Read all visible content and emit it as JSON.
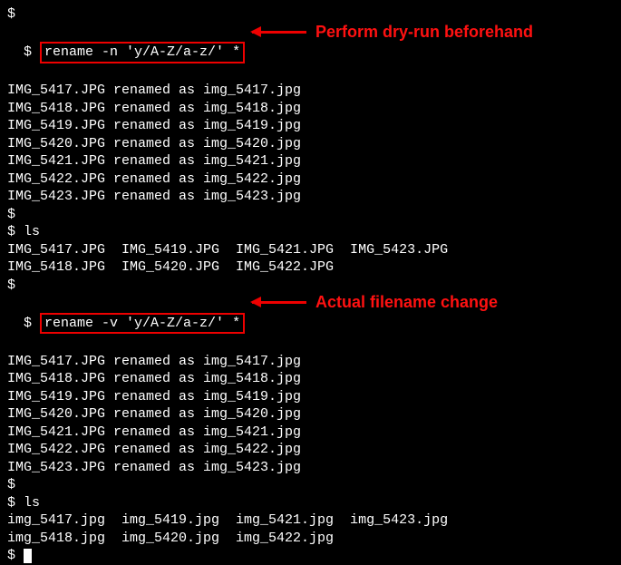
{
  "prompt": "$",
  "block1": {
    "prefix": "$ ",
    "cmd": "rename -n 'y/A-Z/a-z/' *",
    "annotation": "Perform dry-run beforehand",
    "output": [
      "IMG_5417.JPG renamed as img_5417.jpg",
      "IMG_5418.JPG renamed as img_5418.jpg",
      "IMG_5419.JPG renamed as img_5419.jpg",
      "IMG_5420.JPG renamed as img_5420.jpg",
      "IMG_5421.JPG renamed as img_5421.jpg",
      "IMG_5422.JPG renamed as img_5422.jpg",
      "IMG_5423.JPG renamed as img_5423.jpg"
    ]
  },
  "ls1": {
    "cmd": "$ ls",
    "output": [
      "IMG_5417.JPG  IMG_5419.JPG  IMG_5421.JPG  IMG_5423.JPG",
      "IMG_5418.JPG  IMG_5420.JPG  IMG_5422.JPG"
    ]
  },
  "block2": {
    "prefix": "$ ",
    "cmd": "rename -v 'y/A-Z/a-z/' *",
    "annotation": "Actual filename change",
    "output": [
      "IMG_5417.JPG renamed as img_5417.jpg",
      "IMG_5418.JPG renamed as img_5418.jpg",
      "IMG_5419.JPG renamed as img_5419.jpg",
      "IMG_5420.JPG renamed as img_5420.jpg",
      "IMG_5421.JPG renamed as img_5421.jpg",
      "IMG_5422.JPG renamed as img_5422.jpg",
      "IMG_5423.JPG renamed as img_5423.jpg"
    ]
  },
  "ls2": {
    "cmd": "$ ls",
    "output": [
      "img_5417.jpg  img_5419.jpg  img_5421.jpg  img_5423.jpg",
      "img_5418.jpg  img_5420.jpg  img_5422.jpg"
    ]
  },
  "final_prompt": "$ "
}
